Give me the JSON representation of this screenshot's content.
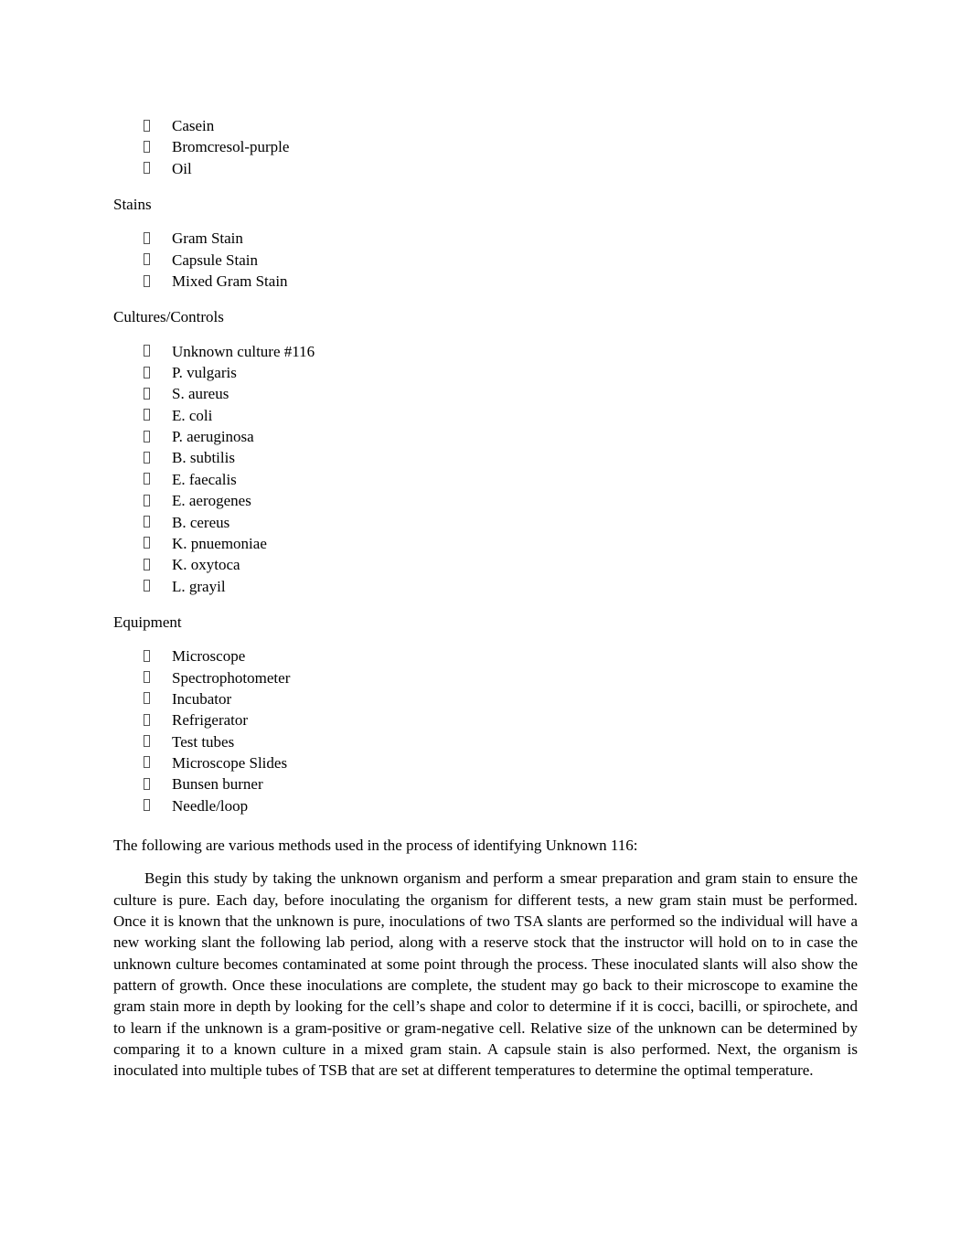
{
  "document": {
    "page_background": "#ffffff",
    "text_color": "#000000",
    "bullet_glyph": "missing-glyph-box"
  },
  "blocks": [
    {
      "kind": "list",
      "name": "media-reagents-list",
      "items": [
        {
          "label": "Casein"
        },
        {
          "label": "Bromcresol-purple"
        },
        {
          "label": "Oil"
        }
      ]
    },
    {
      "kind": "heading",
      "name": "heading-stains",
      "text": "Stains"
    },
    {
      "kind": "list",
      "name": "stains-list",
      "items": [
        {
          "label": "Gram Stain"
        },
        {
          "label": "Capsule Stain"
        },
        {
          "label": "Mixed Gram Stain"
        }
      ]
    },
    {
      "kind": "heading",
      "name": "heading-cultures-controls",
      "text": "Cultures/Controls"
    },
    {
      "kind": "list",
      "name": "cultures-controls-list",
      "items": [
        {
          "label": "Unknown culture #116"
        },
        {
          "label": "P. vulgaris"
        },
        {
          "label": "S. aureus"
        },
        {
          "label": "E. coli"
        },
        {
          "label": "P. aeruginosa"
        },
        {
          "label": "B. subtilis"
        },
        {
          "label": "E. faecalis"
        },
        {
          "label": "E. aerogenes"
        },
        {
          "label": "B. cereus"
        },
        {
          "label": "K. pnuemoniae"
        },
        {
          "label": "K. oxytoca"
        },
        {
          "label": "L. grayil"
        }
      ]
    },
    {
      "kind": "heading",
      "name": "heading-equipment",
      "text": "Equipment"
    },
    {
      "kind": "list",
      "name": "equipment-list",
      "items": [
        {
          "label": "Microscope"
        },
        {
          "label": "Spectrophotometer"
        },
        {
          "label": "Incubator"
        },
        {
          "label": "Refrigerator"
        },
        {
          "label": "Test tubes"
        },
        {
          "label": "Microscope Slides"
        },
        {
          "label": "Bunsen burner"
        },
        {
          "label": "Needle/loop"
        }
      ]
    }
  ],
  "lead_line": "The following are various methods used in the process of identifying Unknown 116:",
  "body_paragraph": "Begin this study by taking the unknown organism and perform a smear preparation and gram stain to ensure the culture is pure. Each day, before inoculating the organism for different tests, a new gram stain must be performed. Once it is known that the unknown is pure, inoculations of two TSA slants are performed so the individual will have a new working slant the following lab period, along with a reserve stock that the instructor will hold on to in case the unknown culture becomes contaminated at some point through the process. These inoculated slants will also show the pattern of growth. Once these inoculations are complete, the student may go back to their microscope to examine the gram stain more in depth by looking for the cell’s shape and color to determine if it is cocci, bacilli, or spirochete, and to learn if the unknown is a gram-positive or gram-negative cell. Relative size of the unknown can be determined by comparing it to a known culture in a mixed gram stain. A capsule stain is also performed. Next, the organism is inoculated into multiple tubes of TSB that are set at different temperatures to determine the optimal temperature."
}
